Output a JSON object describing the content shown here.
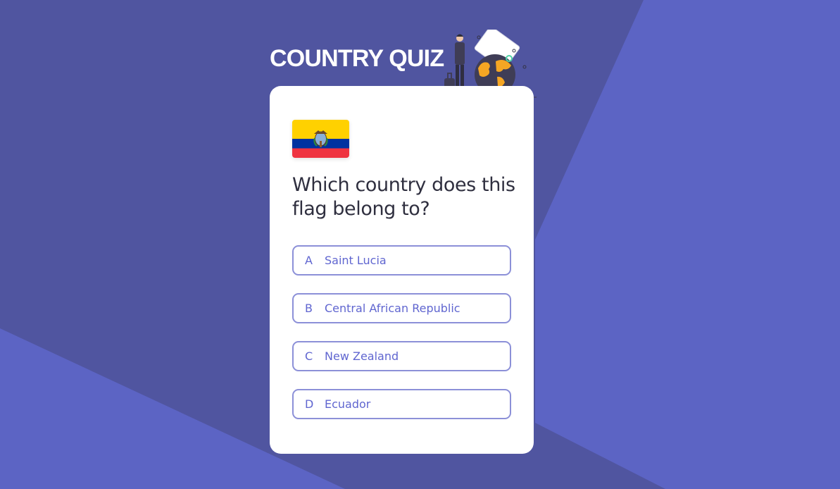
{
  "app": {
    "title": "COUNTRY QUIZ"
  },
  "question": {
    "flag": "Ecuador flag",
    "text": "Which country does this flag belong to?"
  },
  "options": [
    {
      "letter": "A",
      "label": "Saint Lucia"
    },
    {
      "letter": "B",
      "label": "Central African Republic"
    },
    {
      "letter": "C",
      "label": "New Zealand"
    },
    {
      "letter": "D",
      "label": "Ecuador"
    }
  ],
  "colors": {
    "background_dark": "#5055a0",
    "background_light": "#5c64c4",
    "card": "#ffffff",
    "option_border": "#8c90d8",
    "option_text": "#6066d0",
    "question_text": "#2f2f3f"
  }
}
